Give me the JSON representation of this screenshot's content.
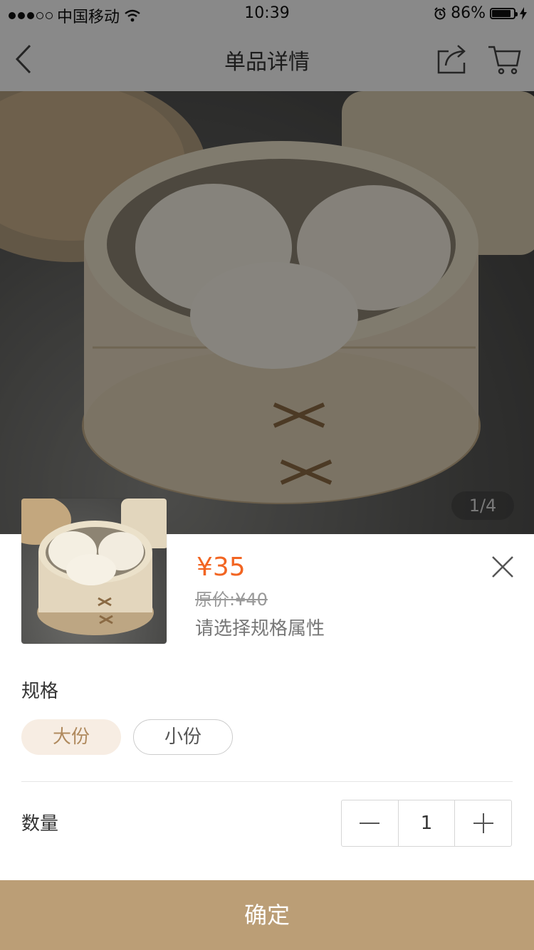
{
  "status_bar": {
    "carrier": "中国移动",
    "time": "10:39",
    "battery_percent": "86%",
    "battery_level": 0.86
  },
  "nav": {
    "title": "单品详情",
    "back_icon": "chevron-left-icon",
    "share_icon": "share-icon",
    "cart_icon": "cart-icon"
  },
  "gallery": {
    "page_indicator": "1/4"
  },
  "product": {
    "price": "¥35",
    "original_price": "原价:¥40",
    "spec_hint": "请选择规格属性"
  },
  "spec": {
    "label": "规格",
    "options": [
      {
        "label": "大份",
        "selected": true
      },
      {
        "label": "小份",
        "selected": false
      }
    ]
  },
  "quantity": {
    "label": "数量",
    "value": "1"
  },
  "confirm_label": "确定",
  "colors": {
    "price": "#f26522",
    "accent": "#bb9e76",
    "chip_selected_bg": "#f7ede3",
    "chip_selected_text": "#b08a5e"
  }
}
